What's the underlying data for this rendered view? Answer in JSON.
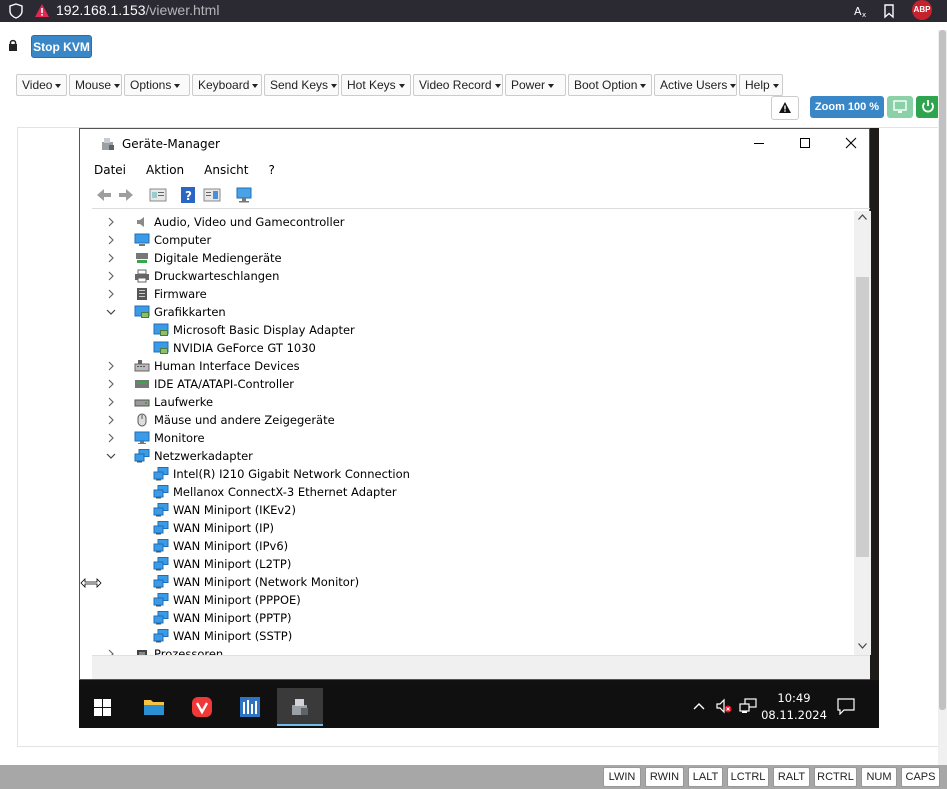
{
  "browser": {
    "url_host": "192.168.1.153",
    "url_path": "/viewer.html",
    "abp_label": "ABP"
  },
  "kvm": {
    "stop_label": "Stop KVM",
    "menus": [
      "Video",
      "Mouse",
      "Options",
      "Keyboard",
      "Send Keys",
      "Hot Keys",
      "Video Record",
      "Power",
      "Boot Option",
      "Active Users",
      "Help"
    ],
    "zoom_label": "Zoom 100 %"
  },
  "device_manager": {
    "title": "Geräte-Manager",
    "menu": [
      "Datei",
      "Aktion",
      "Ansicht",
      "?"
    ],
    "tree": [
      {
        "label": "Audio, Video und Gamecontroller",
        "level": 0,
        "state": "collapsed",
        "icon": "audio-icon"
      },
      {
        "label": "Computer",
        "level": 0,
        "state": "collapsed",
        "icon": "computer-icon"
      },
      {
        "label": "Digitale Mediengeräte",
        "level": 0,
        "state": "collapsed",
        "icon": "media-icon"
      },
      {
        "label": "Druckwarteschlangen",
        "level": 0,
        "state": "collapsed",
        "icon": "printer-icon"
      },
      {
        "label": "Firmware",
        "level": 0,
        "state": "collapsed",
        "icon": "firmware-icon"
      },
      {
        "label": "Grafikkarten",
        "level": 0,
        "state": "expanded",
        "icon": "display-adapter-icon"
      },
      {
        "label": "Microsoft Basic Display Adapter",
        "level": 1,
        "state": "leaf",
        "icon": "display-adapter-icon"
      },
      {
        "label": "NVIDIA GeForce GT 1030",
        "level": 1,
        "state": "leaf",
        "icon": "display-adapter-icon"
      },
      {
        "label": "Human Interface Devices",
        "level": 0,
        "state": "collapsed",
        "icon": "hid-icon"
      },
      {
        "label": "IDE ATA/ATAPI-Controller",
        "level": 0,
        "state": "collapsed",
        "icon": "ide-icon"
      },
      {
        "label": "Laufwerke",
        "level": 0,
        "state": "collapsed",
        "icon": "drive-icon"
      },
      {
        "label": "Mäuse und andere Zeigegeräte",
        "level": 0,
        "state": "collapsed",
        "icon": "mouse-icon"
      },
      {
        "label": "Monitore",
        "level": 0,
        "state": "collapsed",
        "icon": "monitor-icon"
      },
      {
        "label": "Netzwerkadapter",
        "level": 0,
        "state": "expanded",
        "icon": "network-icon"
      },
      {
        "label": "Intel(R) I210 Gigabit Network Connection",
        "level": 1,
        "state": "leaf",
        "icon": "network-icon"
      },
      {
        "label": "Mellanox ConnectX-3 Ethernet Adapter",
        "level": 1,
        "state": "leaf",
        "icon": "network-icon"
      },
      {
        "label": "WAN Miniport (IKEv2)",
        "level": 1,
        "state": "leaf",
        "icon": "network-icon"
      },
      {
        "label": "WAN Miniport (IP)",
        "level": 1,
        "state": "leaf",
        "icon": "network-icon"
      },
      {
        "label": "WAN Miniport (IPv6)",
        "level": 1,
        "state": "leaf",
        "icon": "network-icon"
      },
      {
        "label": "WAN Miniport (L2TP)",
        "level": 1,
        "state": "leaf",
        "icon": "network-icon"
      },
      {
        "label": "WAN Miniport (Network Monitor)",
        "level": 1,
        "state": "leaf",
        "icon": "network-icon"
      },
      {
        "label": "WAN Miniport (PPPOE)",
        "level": 1,
        "state": "leaf",
        "icon": "network-icon"
      },
      {
        "label": "WAN Miniport (PPTP)",
        "level": 1,
        "state": "leaf",
        "icon": "network-icon"
      },
      {
        "label": "WAN Miniport (SSTP)",
        "level": 1,
        "state": "leaf",
        "icon": "network-icon"
      },
      {
        "label": "Prozessoren",
        "level": 0,
        "state": "collapsed",
        "icon": "cpu-icon"
      }
    ]
  },
  "taskbar": {
    "time": "10:49",
    "date": "08.11.2024"
  },
  "keys": [
    "LWIN",
    "RWIN",
    "LALT",
    "LCTRL",
    "RALT",
    "RCTRL",
    "NUM",
    "CAPS"
  ],
  "colors": {
    "primary": "#3a87c8",
    "success": "#2ea44f",
    "success_light": "#8bd1a8"
  }
}
